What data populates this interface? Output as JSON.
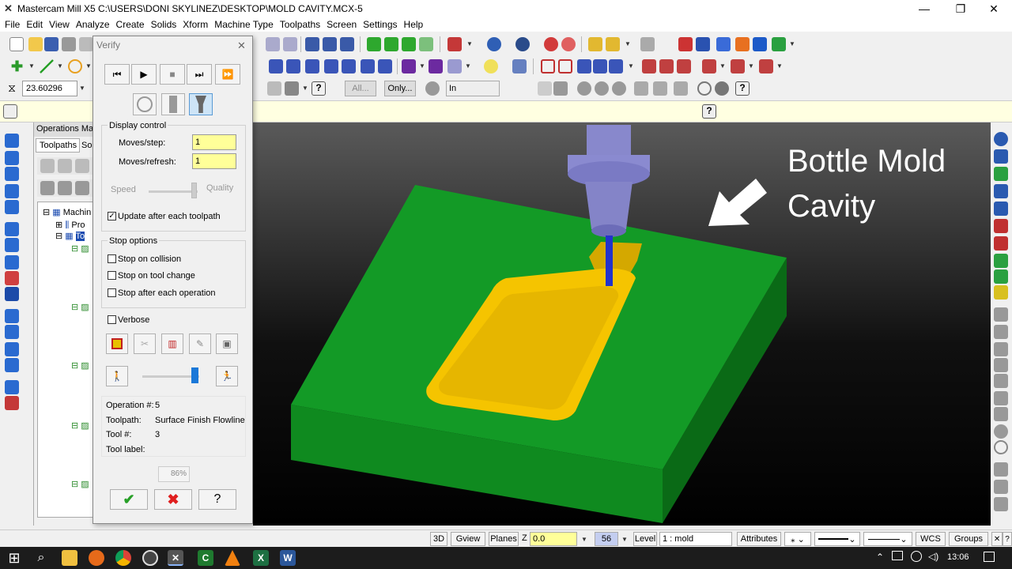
{
  "app": {
    "title": "Mastercam Mill X5  C:\\USERS\\DONI SKYLINEZ\\DESKTOP\\MOLD CAVITY.MCX-5"
  },
  "menu": [
    "File",
    "Edit",
    "View",
    "Analyze",
    "Create",
    "Solids",
    "Xform",
    "Machine Type",
    "Toolpaths",
    "Screen",
    "Settings",
    "Help"
  ],
  "toolbar": {
    "z_value": "23.60296",
    "all_label": "All...",
    "only_label": "Only...",
    "units": "In"
  },
  "ops": {
    "title": "Operations Mana",
    "tab_toolpaths": "Toolpaths",
    "tab_solids": "Sol",
    "machine": "Machin",
    "props": "Pro",
    "toolpaths": "To"
  },
  "verify": {
    "title": "Verify",
    "display_control": "Display control",
    "moves_step_label": "Moves/step:",
    "moves_step": "1",
    "moves_refresh_label": "Moves/refresh:",
    "moves_refresh": "1",
    "speed": "Speed",
    "quality": "Quality",
    "update_label": "Update after each toolpath",
    "update_checked": true,
    "stop_options": "Stop options",
    "stop_collision": "Stop on collision",
    "stop_tool_change": "Stop on tool change",
    "stop_after_op": "Stop after each operation",
    "verbose": "Verbose",
    "operation_label": "Operation #:",
    "operation": "5",
    "toolpath_label": "Toolpath:",
    "toolpath": "Surface Finish Flowline",
    "tool_label": "Tool #:",
    "tool": "3",
    "tool_label_label": "Tool label:",
    "progress": "86%"
  },
  "viewport": {
    "annotation_line1": "Bottle Mold",
    "annotation_line2": "Cavity"
  },
  "status": {
    "b3d": "3D",
    "gview": "Gview",
    "planes": "Planes",
    "z_label": "Z",
    "z": "0.0",
    "color": "56",
    "level_label": "Level",
    "level": "1 : mold",
    "attributes": "Attributes",
    "wcs": "WCS",
    "groups": "Groups"
  },
  "taskbar": {
    "time": "13:06"
  },
  "colors": {
    "part_green": "#0f8a1f",
    "part_dark": "#0a6a16",
    "cavity": "#f5c400",
    "tool": "#8888cc",
    "input_yellow": "#ffff99"
  }
}
